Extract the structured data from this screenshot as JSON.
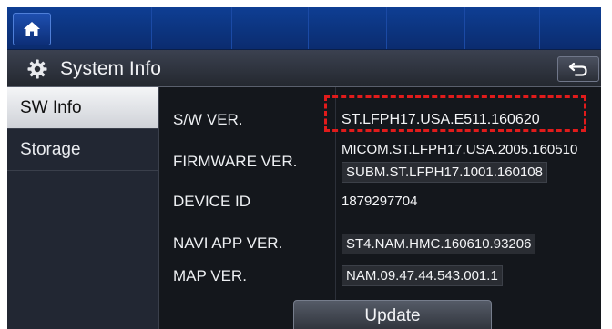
{
  "title_bar": {
    "title": "System Info"
  },
  "sidebar": {
    "items": [
      {
        "label": "SW Info",
        "active": true
      },
      {
        "label": "Storage",
        "active": false
      }
    ]
  },
  "info": {
    "sw_ver": {
      "label": "S/W VER.",
      "value": "ST.LFPH17.USA.E511.160620"
    },
    "firmware_ver": {
      "label": "FIRMWARE VER.",
      "values": [
        "MICOM.ST.LFPH17.USA.2005.160510",
        "SUBM.ST.LFPH17.1001.160108"
      ]
    },
    "device_id": {
      "label": "DEVICE ID",
      "value": "1879297704"
    },
    "navi_app_ver": {
      "label": "NAVI APP VER.",
      "value": "ST4.NAM.HMC.160610.93206"
    },
    "map_ver": {
      "label": "MAP VER.",
      "value": "NAM.09.47.44.543.001.1"
    }
  },
  "update_button": {
    "label": "Update"
  },
  "colors": {
    "highlight": "#e11b1b",
    "top_bar": "#0e3e93"
  }
}
